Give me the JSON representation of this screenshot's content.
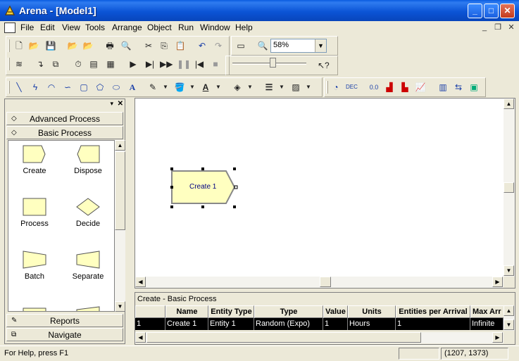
{
  "app": {
    "title": "Arena - [Model1]",
    "window_controls": {
      "minimize": "_",
      "maximize": "□",
      "close": "✕"
    },
    "mdi_controls": {
      "minimize": "_",
      "restore": "❐",
      "close": "✕"
    }
  },
  "menu": [
    "File",
    "Edit",
    "View",
    "Tools",
    "Arrange",
    "Object",
    "Run",
    "Window",
    "Help"
  ],
  "toolbar": {
    "zoom_value": "58%"
  },
  "project_bar": {
    "panels_top": [
      {
        "label": "Advanced Process"
      },
      {
        "label": "Basic Process"
      }
    ],
    "modules": [
      {
        "label": "Create",
        "shape": "create"
      },
      {
        "label": "Dispose",
        "shape": "dispose"
      },
      {
        "label": "Process",
        "shape": "process"
      },
      {
        "label": "Decide",
        "shape": "decide"
      },
      {
        "label": "Batch",
        "shape": "batch"
      },
      {
        "label": "Separate",
        "shape": "separate"
      }
    ],
    "panels_bottom": [
      {
        "label": "Reports"
      },
      {
        "label": "Navigate"
      }
    ]
  },
  "canvas": {
    "module_label": "Create 1"
  },
  "spreadsheet": {
    "title": "Create - Basic Process",
    "columns": [
      "",
      "Name",
      "Entity Type",
      "Type",
      "Value",
      "Units",
      "Entities per Arrival",
      "Max Arr"
    ],
    "row": [
      "1",
      "Create 1",
      "Entity 1",
      "Random (Expo)",
      "1",
      "Hours",
      "1",
      "Infinite"
    ]
  },
  "status": {
    "help": "For Help, press F1",
    "coords": "(1207, 1373)"
  },
  "colors": {
    "titlebar": "#0b54d6",
    "module_fill": "#ffffc0",
    "selected_row": "#000000"
  }
}
